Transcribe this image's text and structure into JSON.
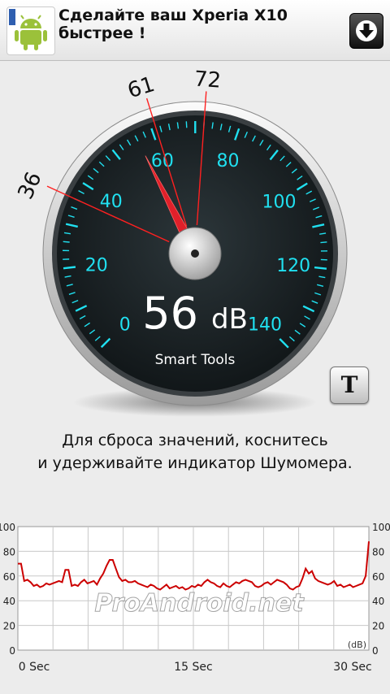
{
  "ad": {
    "title": "Сделайте ваш Xperia X10 быстрее !",
    "app_icon": "android-icon",
    "action_icon": "download-icon"
  },
  "gauge": {
    "scale_labels": [
      "0",
      "20",
      "40",
      "60",
      "80",
      "100",
      "120",
      "140"
    ],
    "reading_value": "56",
    "reading_unit": "dB",
    "brand": "Smart Tools",
    "needle_value": 56,
    "markers": [
      "36",
      "61",
      "72"
    ],
    "marker_values": [
      36,
      61,
      72
    ],
    "accent_color": "#20e0f0",
    "marker_color": "#ff2020"
  },
  "t_button_label": "T",
  "hint": {
    "line1": "Для сброса значений, коснитесь",
    "line2": "и удерживайте индикатор Шумомера."
  },
  "watermark": "ProAndroid.net",
  "chart_data": {
    "type": "line",
    "title": "",
    "xlabel": "",
    "ylabel": "(dB)",
    "x_ticks": [
      "0 Sec",
      "15 Sec",
      "30 Sec"
    ],
    "y_ticks": [
      "0",
      "20",
      "40",
      "60",
      "80",
      "100"
    ],
    "ylim": [
      0,
      100
    ],
    "grid": true,
    "line_color": "#cc0000",
    "values": [
      70,
      70,
      56,
      57,
      55,
      52,
      53,
      51,
      52,
      54,
      53,
      54,
      55,
      56,
      55,
      65,
      65,
      52,
      53,
      52,
      55,
      57,
      54,
      55,
      56,
      53,
      58,
      62,
      68,
      73,
      73,
      66,
      59,
      56,
      57,
      55,
      55,
      56,
      54,
      53,
      52,
      51,
      53,
      52,
      50,
      49,
      51,
      53,
      50,
      51,
      52,
      50,
      51,
      49,
      50,
      52,
      51,
      53,
      52,
      55,
      57,
      55,
      54,
      52,
      51,
      54,
      52,
      51,
      53,
      55,
      54,
      56,
      57,
      56,
      55,
      52,
      51,
      52,
      54,
      55,
      53,
      55,
      57,
      56,
      55,
      53,
      50,
      49,
      51,
      52,
      58,
      66,
      62,
      64,
      58,
      56,
      55,
      54,
      53,
      54,
      56,
      52,
      53,
      51,
      52,
      53,
      51,
      52,
      53,
      54,
      60,
      88
    ]
  }
}
